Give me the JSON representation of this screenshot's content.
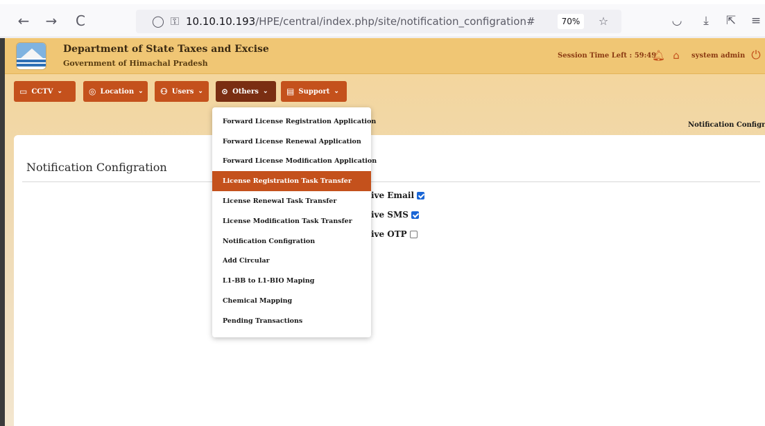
{
  "browser": {
    "back": "←",
    "forward": "→",
    "reload": "C",
    "url_host": "10.10.10.193",
    "url_path": "/HPE/central/index.php/site/notification_configration#",
    "zoom": "70%"
  },
  "header": {
    "title": "Department of State Taxes and Excise",
    "subtitle": "Government of Himachal Pradesh",
    "session": "Session Time Left : 59:49",
    "user": "system admin"
  },
  "nav": [
    {
      "label": "CCTV"
    },
    {
      "label": "Location"
    },
    {
      "label": "Users"
    },
    {
      "label": "Others"
    },
    {
      "label": "Support"
    }
  ],
  "breadcrumb": "Notification Configratio",
  "page": {
    "title": "Notification Configration",
    "options": [
      {
        "label": "ceive Email",
        "checked": true
      },
      {
        "label": "ceive SMS",
        "checked": true
      },
      {
        "label": "ceive OTP",
        "checked": false
      }
    ]
  },
  "dropdown": {
    "items": [
      "Forward License Registration Application",
      "Forward License Renewal Application",
      "Forward License Modification Application",
      "License Registration Task Transfer",
      "License Renewal Task Transfer",
      "License Modification Task Transfer",
      "Notification Configration",
      "Add Circular",
      "L1-BB to L1-BIO Maping",
      "Chemical Mapping",
      "Pending Transactions"
    ],
    "active_index": 3
  },
  "colors": {
    "nav": "#c4511c",
    "nav_active": "#7a2e12",
    "header": "#f0c674",
    "accent_checkbox": "#1a66d6"
  }
}
